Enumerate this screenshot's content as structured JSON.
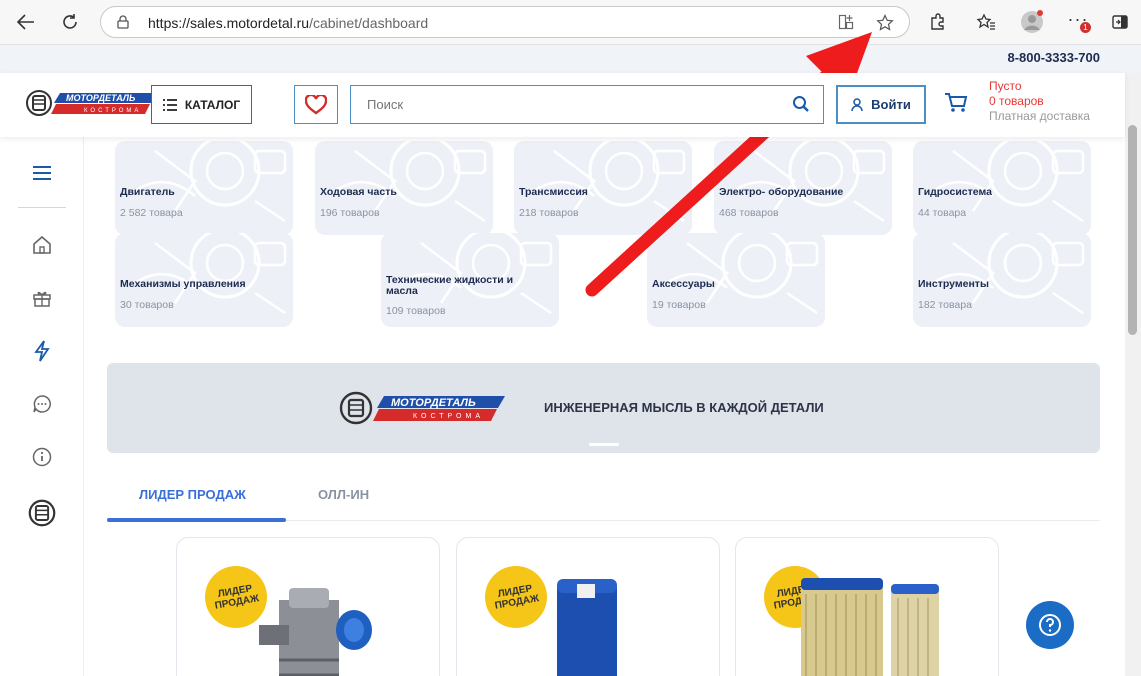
{
  "browser": {
    "url_host": "https://sales.motordetal.ru",
    "url_path": "/cabinet/dashboard",
    "notification_count": "1"
  },
  "site": {
    "phone": "8-800-3333-700",
    "logo_text": "МОТОРДЕТАЛЬ",
    "logo_subtext": "КОСТРОМА",
    "catalog_label": "КАТАЛОГ",
    "search_placeholder": "Поиск",
    "login_label": "Войти",
    "cart_status": "Пусто",
    "cart_count": "0 товаров",
    "cart_delivery": "Платная доставка"
  },
  "categories": [
    {
      "name": "Двигатель",
      "count": "2 582 товара"
    },
    {
      "name": "Ходовая часть",
      "count": "196 товаров"
    },
    {
      "name": "Трансмиссия",
      "count": "218 товаров"
    },
    {
      "name": "Электро- оборудование",
      "count": "468 товаров"
    },
    {
      "name": "Гидросистема",
      "count": "44 товара"
    },
    {
      "name": "Механизмы управления",
      "count": "30 товаров"
    },
    {
      "name": "Технические жидкости и масла",
      "count": "109 товаров"
    },
    {
      "name": "Аксессуары",
      "count": "19 товаров"
    },
    {
      "name": "Инструменты",
      "count": "182 товара"
    }
  ],
  "banner": {
    "tagline": "ИНЖЕНЕРНАЯ МЫСЛЬ В КАЖДОЙ ДЕТАЛИ"
  },
  "tabs": [
    {
      "label": "ЛИДЕР ПРОДАЖ",
      "active": true
    },
    {
      "label": "ОЛЛ-ИН",
      "active": false
    }
  ],
  "products": [
    {
      "badge": "ЛИДЕР ПРОДАЖ"
    },
    {
      "badge": "ЛИДЕР ПРОДАЖ"
    },
    {
      "badge": "ЛИДЕР ПРОДАЖ"
    }
  ],
  "colors": {
    "accent": "#3a6fd8",
    "brand_red": "#e53935",
    "annotation_arrow": "#ee1c1c"
  }
}
